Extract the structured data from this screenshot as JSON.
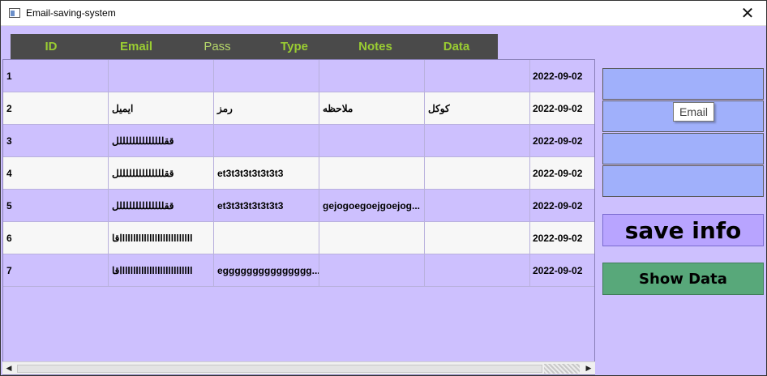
{
  "window": {
    "title": "Email-saving-system",
    "close_glyph": "✕"
  },
  "headers": [
    "ID",
    "Email",
    "Pass",
    "Type",
    "Notes",
    "Data"
  ],
  "rows": [
    [
      "1",
      "",
      "",
      "",
      "",
      "2022-09-02"
    ],
    [
      "2",
      "ايميل",
      "رمز",
      "ملاحظه",
      "كوكل",
      "2022-09-02"
    ],
    [
      "3",
      "ققللللللللللللللل",
      "",
      "",
      "",
      "2022-09-02"
    ],
    [
      "4",
      "ققللللللللللللللل",
      "et3t3t3t3t3t3t3",
      "",
      "",
      "2022-09-02"
    ],
    [
      "5",
      "ققللللللللللللللل",
      "et3t3t3t3t3t3t3",
      "gejogoegoejgoejog...",
      "",
      "2022-09-02"
    ],
    [
      "6",
      "اقاllllllllllllllllllllllllll",
      "",
      "",
      "",
      "2022-09-02"
    ],
    [
      "7",
      "اقاllllllllllllllllllllllllll",
      "eggggggggggggggg...",
      "",
      "",
      "2022-09-02"
    ]
  ],
  "form": {
    "tooltip": "Email",
    "save_label": "save info",
    "show_label": "Show Data"
  },
  "colors": {
    "background": "#cdc0fe",
    "header_bar": "#4a4a4a",
    "header_text": "#9acd32",
    "input": "#a0b0fb",
    "save_button": "#b8a4ff",
    "show_button": "#58a87a"
  }
}
